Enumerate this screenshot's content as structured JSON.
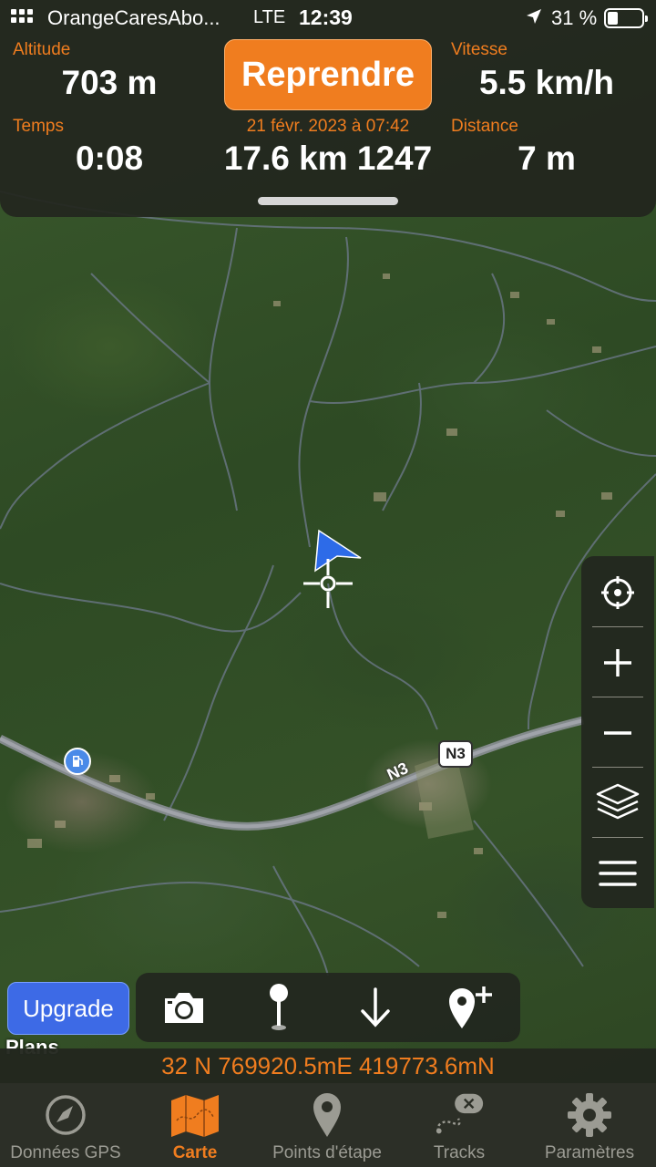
{
  "status_bar": {
    "carrier": "OrangeCaresAbo...",
    "network": "LTE",
    "time": "12:39",
    "battery_percent": "31 %",
    "battery_level": 0.31
  },
  "stats": {
    "altitude_label": "Altitude",
    "altitude_value": "703 m",
    "speed_label": "Vitesse",
    "speed_value": "5.5 km/h",
    "time_label": "Temps",
    "time_value": "0:08",
    "date_label": "21 févr. 2023 à 07:42",
    "track_value": "17.6 km 1247",
    "distance_label": "Distance",
    "distance_value": "7 m"
  },
  "resume_button": "Reprendre",
  "map": {
    "road_shield": "N3",
    "road_label": "N3",
    "attribution": "Plans"
  },
  "upgrade_button": "Upgrade",
  "coordinates": "32 N 769920.5mE 419773.6mN",
  "tabs": [
    {
      "label": "Données GPS",
      "icon": "compass-icon"
    },
    {
      "label": "Carte",
      "icon": "map-icon"
    },
    {
      "label": "Points d'étape",
      "icon": "pin-icon"
    },
    {
      "label": "Tracks",
      "icon": "track-icon"
    },
    {
      "label": "Paramètres",
      "icon": "gear-icon"
    }
  ],
  "colors": {
    "accent": "#f07d1f",
    "upgrade": "#3d6ae6",
    "panel": "#22261e"
  }
}
